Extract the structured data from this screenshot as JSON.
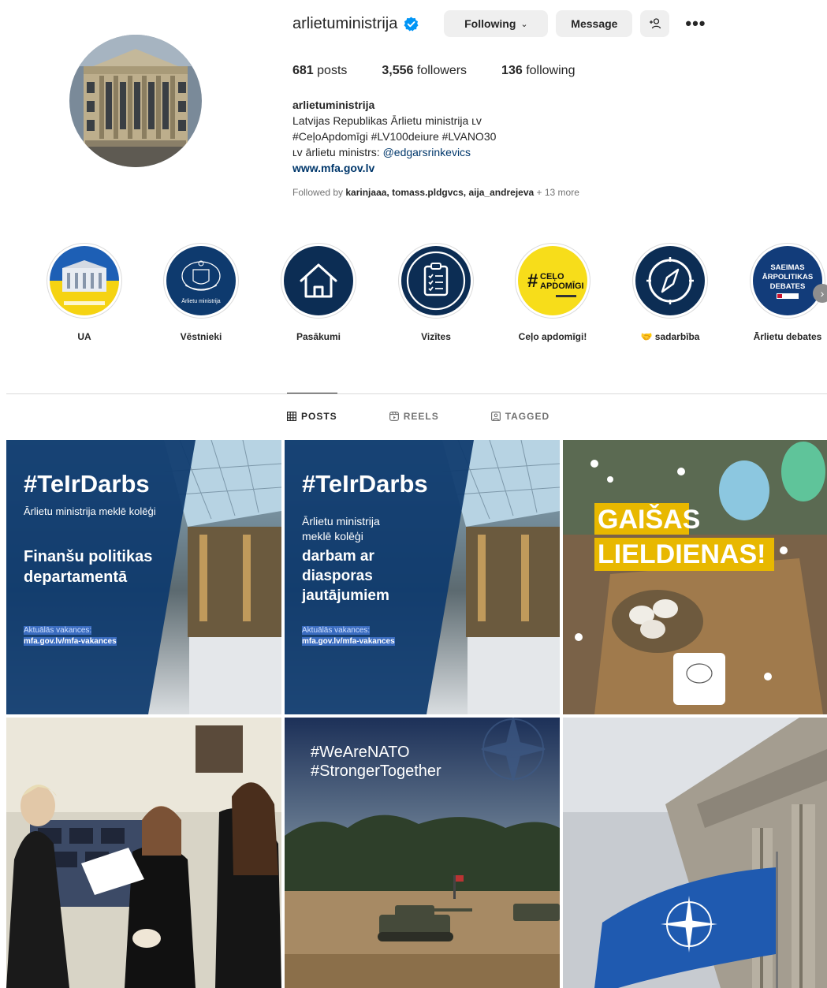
{
  "profile": {
    "username": "arlietuministrija",
    "following_label": "Following",
    "message_label": "Message",
    "stats": {
      "posts_count": "681",
      "posts_label": "posts",
      "followers_count": "3,556",
      "followers_label": "followers",
      "following_count": "136",
      "following_label": "following"
    },
    "bio": {
      "name": "arlietuministrija",
      "line1": "Latvijas Republikas Ārlietu ministrija ʟᴠ",
      "line2": "#CeļoApdomīgi #LV100deiure #LVANO30",
      "line3_prefix": "ʟᴠ ārlietu ministrs: ",
      "line3_mention": "@edgarsrinkevics",
      "link": "www.mfa.gov.lv"
    },
    "followed_by": {
      "prefix": "Followed by ",
      "users": "karinjaaa, tomass.pldgvcs, aija_andrejeva",
      "more": " + 13 more"
    }
  },
  "highlights": [
    {
      "label": "UA",
      "icon": "ukraine-building"
    },
    {
      "label": "Vēstnieki",
      "icon": "coat-of-arms",
      "inner_text": "Ārlietu ministrija"
    },
    {
      "label": "Pasākumi",
      "icon": "house-icon"
    },
    {
      "label": "Vizītes",
      "icon": "clipboard-icon"
    },
    {
      "label": "Ceļo apdomīgi!",
      "icon": "celo-apdomigi",
      "inner_text": "#CEĻO APDOMĪGI"
    },
    {
      "label": "🤝 sadarbība",
      "icon": "compass-icon"
    },
    {
      "label": "Ārlietu debates",
      "icon": "saeimas-debates",
      "inner_text": "SAEIMAS ĀRPOLITIKAS DEBATES"
    }
  ],
  "tabs": [
    {
      "label": "POSTS",
      "icon": "grid-icon",
      "active": true
    },
    {
      "label": "REELS",
      "icon": "reels-icon",
      "active": false
    },
    {
      "label": "TAGGED",
      "icon": "tagged-icon",
      "active": false
    }
  ],
  "posts": [
    {
      "hashtag": "#TeIrDarbs",
      "sub": "Ārlietu ministrija meklē kolēģi",
      "title1": "Finanšu politikas",
      "title2": "departamentā",
      "vac_label": "Aktuālās vakances:",
      "vac_link": "mfa.gov.lv/mfa-vakances"
    },
    {
      "hashtag": "#TeIrDarbs",
      "sub1": "Ārlietu ministrija",
      "sub2": "meklē kolēģi",
      "title1": "darbam ar",
      "title2": "diasporas",
      "title3": "jautājumiem",
      "vac_label": "Aktuālās vakances:",
      "vac_link": "mfa.gov.lv/mfa-vakances"
    },
    {
      "line1": "GAIŠAS",
      "line2": "LIELDIENAS!"
    },
    {
      "description": "meeting-photo"
    },
    {
      "line1": "#WeAreNATO",
      "line2": "#StrongerTogether"
    },
    {
      "description": "nato-flag-photo"
    }
  ],
  "colors": {
    "mfa_blue": "#0e3a6e",
    "verified_blue": "#0095f6",
    "link_blue": "#00376b",
    "easter_yellow": "#f2c200"
  }
}
